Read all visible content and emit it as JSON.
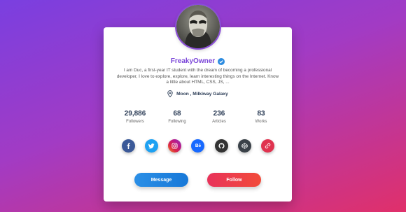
{
  "profile": {
    "name": "FreakyOwner",
    "bio": "I am Duc, a first-year IT student with the dream of becoming a professional developer, I love to explore, explore, learn interesting things on the Internet. Know a little about HTML, CSS, JS, ...",
    "location": "Moon , Milkiway Galaxy"
  },
  "stats": [
    {
      "value": "29,886",
      "label": "Followers"
    },
    {
      "value": "68",
      "label": "Following"
    },
    {
      "value": "236",
      "label": "Articles"
    },
    {
      "value": "83",
      "label": "Works"
    }
  ],
  "socials": [
    {
      "icon": "facebook-icon",
      "glyph": "f",
      "color": "#3b5998"
    },
    {
      "icon": "twitter-icon",
      "glyph": "t",
      "color": "#1da1f2"
    },
    {
      "icon": "instagram-icon",
      "glyph": "ig",
      "color": "#c13584"
    },
    {
      "icon": "behance-icon",
      "glyph": "Bē",
      "color": "#1769ff"
    },
    {
      "icon": "github-icon",
      "glyph": "gh",
      "color": "#333333"
    },
    {
      "icon": "codepen-icon",
      "glyph": "cp",
      "color": "#3a4148"
    },
    {
      "icon": "link-icon",
      "glyph": "lk",
      "color": "#e0334f"
    }
  ],
  "buttons": {
    "message": "Message",
    "follow": "Follow"
  },
  "colors": {
    "accent": "#7a45d8",
    "verified": "#2d8ce0",
    "message": "#1f85e0",
    "follow": "#ec3b4c"
  }
}
